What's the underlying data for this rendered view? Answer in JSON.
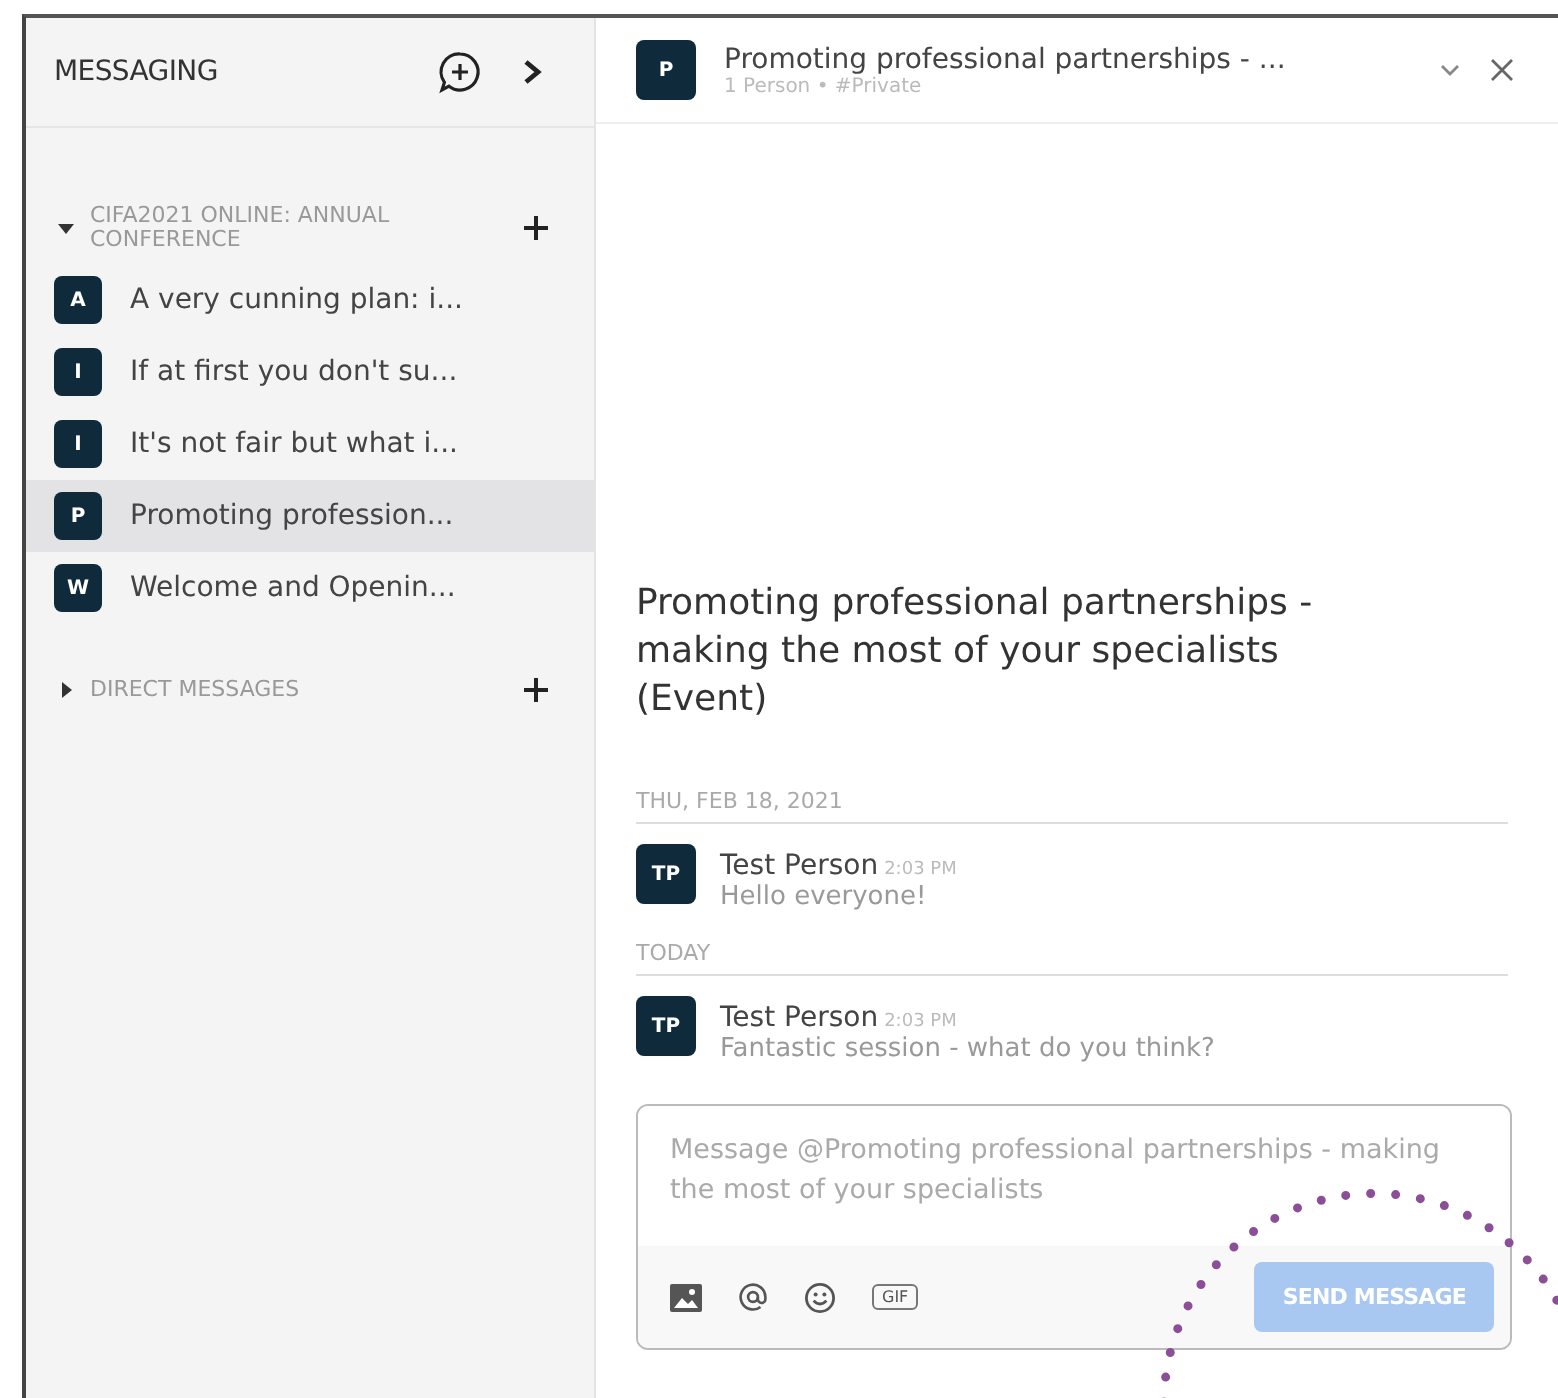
{
  "sidebar": {
    "title": "MESSAGING",
    "sections": [
      {
        "name": "CIFA2021 ONLINE: ANNUAL CONFERENCE",
        "expanded": true,
        "channels": [
          {
            "initial": "A",
            "name": "A very cunning plan: i...",
            "selected": false
          },
          {
            "initial": "I",
            "name": "If at first you don't su...",
            "selected": false
          },
          {
            "initial": "I",
            "name": "It's not fair but what i...",
            "selected": false
          },
          {
            "initial": "P",
            "name": "Promoting profession...",
            "selected": true
          },
          {
            "initial": "W",
            "name": "Welcome and Openin...",
            "selected": false
          }
        ]
      },
      {
        "name": "DIRECT MESSAGES",
        "expanded": false
      }
    ]
  },
  "header": {
    "initial": "P",
    "title": "Promoting professional partnerships - ...",
    "subtitle": "1 Person • #Private"
  },
  "channel_title": "Promoting professional partnerships - making the most of your specialists (Event)",
  "days": [
    {
      "label": "THU, FEB 18, 2021",
      "messages": [
        {
          "initials": "TP",
          "author": "Test Person",
          "time": "2:03 PM",
          "text": "Hello everyone!"
        }
      ]
    },
    {
      "label": "TODAY",
      "messages": [
        {
          "initials": "TP",
          "author": "Test Person",
          "time": "2:03 PM",
          "text": "Fantastic session - what do you think?"
        }
      ]
    }
  ],
  "composer": {
    "placeholder": "Message @Promoting professional partnerships - making the most of your specialists",
    "tools": [
      {
        "kind": "image"
      },
      {
        "kind": "mention"
      },
      {
        "kind": "emoji"
      },
      {
        "kind": "gif",
        "label": "GIF"
      }
    ],
    "send": {
      "label": "SEND MESSAGE",
      "disabled": true
    }
  }
}
